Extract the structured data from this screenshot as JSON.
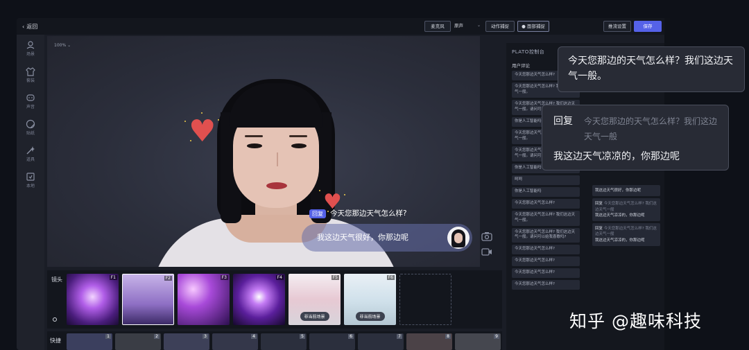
{
  "topbar": {
    "back_label": "返回",
    "microphone_label": "麦克风",
    "sound_source_value": "原声",
    "motion_capture_label": "动作捕捉",
    "face_capture_label": "● 面部捕捉",
    "stream_settings_label": "推流设置",
    "save_label": "保存"
  },
  "sidebar": {
    "items": [
      {
        "label": "场景",
        "icon": "scene-icon"
      },
      {
        "label": "套装",
        "icon": "outfit-icon"
      },
      {
        "label": "声音",
        "icon": "voice-icon"
      },
      {
        "label": "贴纸",
        "icon": "sticker-icon"
      },
      {
        "label": "道具",
        "icon": "prop-icon"
      },
      {
        "label": "本地",
        "icon": "local-folder-icon"
      }
    ]
  },
  "stage": {
    "zoom": "100%",
    "reply_tag": "回复",
    "question": "今天您那边天气怎么样?",
    "answer": "我这边天气很好，你那边呢"
  },
  "cameras": {
    "label": "镜头",
    "items": [
      {
        "key": "F1",
        "caption": ""
      },
      {
        "key": "F2",
        "caption": ""
      },
      {
        "key": "F3",
        "caption": ""
      },
      {
        "key": "F4",
        "caption": ""
      },
      {
        "key": "F5",
        "caption": "非当前场景"
      },
      {
        "key": "F6",
        "caption": "非当前场景"
      }
    ]
  },
  "shortcuts": {
    "label": "快捷",
    "slots": [
      "1",
      "2",
      "3",
      "4",
      "5",
      "6",
      "7",
      "8",
      "9"
    ]
  },
  "panel": {
    "title": "PLATO控制台",
    "comments_label": "用户评论",
    "comments": [
      "今天您那边天气怎么样?",
      "今天您那边天气怎么样? 我们这边天气一般。",
      "今天您那边天气怎么样? 我们这边天气一般。请问可以给我喜歌吗?",
      "你是人工智能吗",
      "今天您那边天气怎么样? 我们这边天气一般。",
      "今天您那边天气怎么样? 我们这边天气一般。请问可以给我喜歌吗?",
      "你是人工智能吗",
      "呵呵",
      "你是人工智能吗",
      "今天您那边天气怎么样?",
      "今天您那边天气怎么样? 我们这边天气一般。",
      "今天您那边天气怎么样? 我们这边天气一般。请问可以给我喜歌吗?",
      "今天您那边天气怎么样?",
      "今天您那边天气怎么样?",
      "今天您那边天气怎么样?",
      "今天您那边天气怎么样?"
    ],
    "replies": [
      {
        "tag": "",
        "q": "",
        "a": "我这边天气很好，你那边呢"
      },
      {
        "tag": "回复",
        "q": "今天您那边天气怎么样? 我们这边天气一般",
        "a": "我这边天气凉凉的，你那边呢"
      },
      {
        "tag": "回复",
        "q": "今天您那边天气怎么样? 我们这边天气一般",
        "a": "我这边天气凉凉的，你那边呢"
      }
    ]
  },
  "popup1": {
    "text": "今天您那边的天气怎么样？我们这边天气一般。"
  },
  "popup2": {
    "tag": "回复",
    "question": "今天您那边的天气怎么样？我们这边天气一般",
    "answer": "我这边天气凉凉的，你那边呢"
  },
  "watermark": "知乎 @趣味科技",
  "colors": {
    "accent": "#5562e8",
    "heart": "#e0504f"
  }
}
